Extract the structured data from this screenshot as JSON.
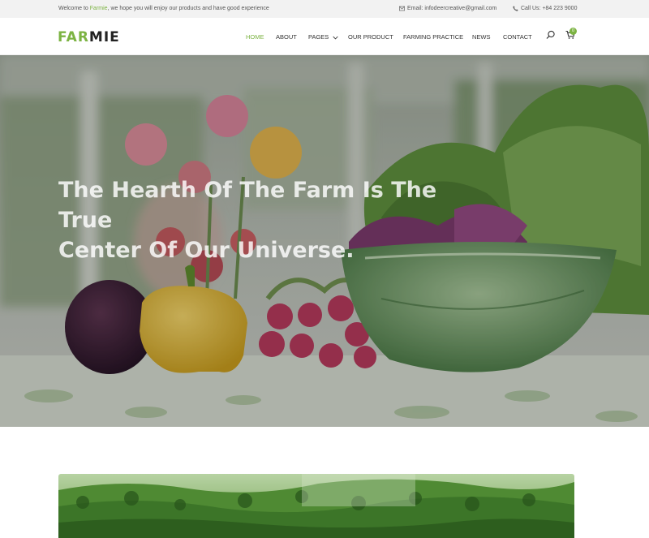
{
  "topbar": {
    "welcome_prefix": "Welcome to ",
    "welcome_brand": "Farmie",
    "welcome_suffix": ", we hope you will enjoy our products and have good experience",
    "email": "Email: infodeercreative@gmail.com",
    "phone": "Call Us: +84 223 9000"
  },
  "header": {
    "logo_part1": "FAR",
    "logo_part2": "MIE",
    "nav": {
      "home": "HOME",
      "about": "ABOUT",
      "pages": "PAGES",
      "our_product": "OUR PRODUCT",
      "farming_practice": "FARMING PRACTICE",
      "news": "NEWS",
      "contact": "CONTACT"
    },
    "cart_count": "0"
  },
  "hero": {
    "title_line1": "The Hearth Of The Farm Is The True",
    "title_line2": "Center Of Our Universe."
  },
  "colors": {
    "accent": "#7cb342",
    "topbar_bg": "#f2f2f2"
  },
  "icons": {
    "email": "envelope-icon",
    "phone": "phone-icon",
    "search": "search-icon",
    "cart": "cart-icon",
    "dropdown": "chevron-down-icon"
  }
}
